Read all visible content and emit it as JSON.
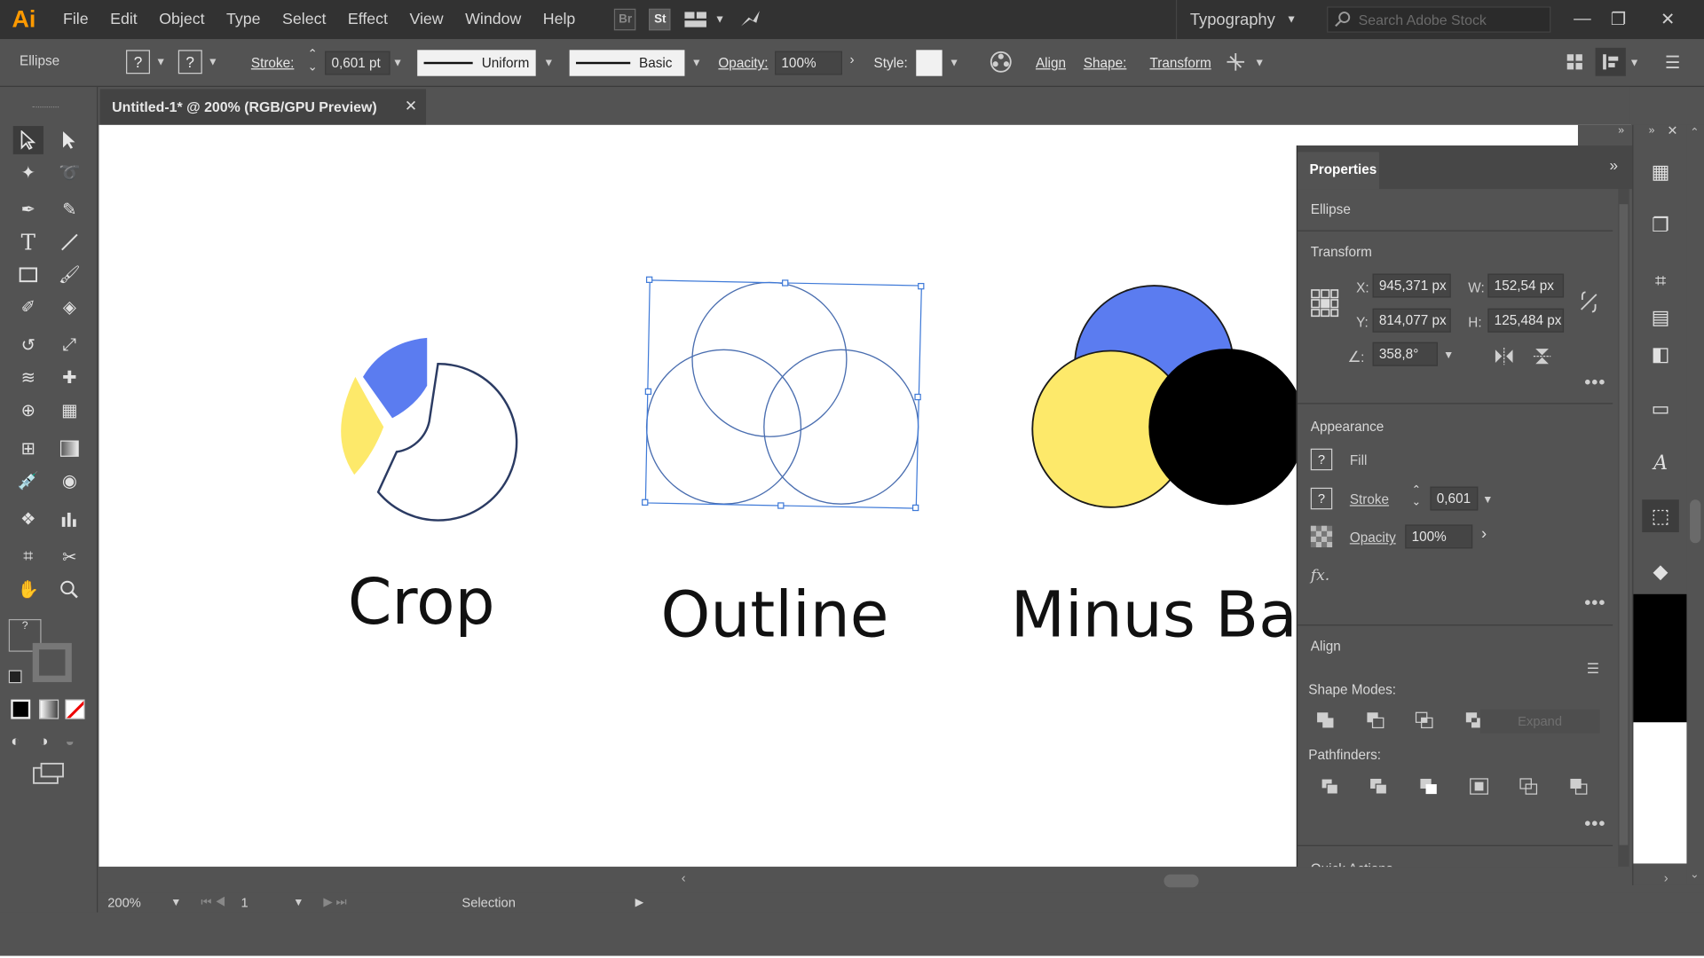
{
  "menubar": {
    "logo": "Ai",
    "items": [
      "File",
      "Edit",
      "Object",
      "Type",
      "Select",
      "Effect",
      "View",
      "Window",
      "Help"
    ],
    "bridge_label": "Br",
    "stock_label": "St",
    "workspace": "Typography",
    "search_placeholder": "Search Adobe Stock"
  },
  "control_bar": {
    "selection_type": "Ellipse",
    "stroke_label": "Stroke:",
    "stroke_value": "0,601 pt",
    "profile_label": "Uniform",
    "brush_label": "Basic",
    "opacity_label": "Opacity:",
    "opacity_value": "100%",
    "style_label": "Style:",
    "align_label": "Align",
    "shape_label": "Shape:",
    "transform_label": "Transform"
  },
  "document": {
    "tab_title": "Untitled-1* @ 200% (RGB/GPU Preview)"
  },
  "artboard": {
    "labels": [
      "Crop",
      "Outline",
      "Minus Bac"
    ],
    "colors": {
      "blue": "#5b7cf0",
      "yellow": "#fde96a",
      "black": "#000000",
      "outline": "#2b3b63",
      "selection": "#4a7bd0"
    }
  },
  "properties": {
    "tab": "Properties",
    "object_type": "Ellipse",
    "transform_title": "Transform",
    "x_label": "X:",
    "x_value": "945,371 px",
    "y_label": "Y:",
    "y_value": "814,077 px",
    "w_label": "W:",
    "w_value": "152,54 px",
    "h_label": "H:",
    "h_value": "125,484 px",
    "angle_value": "358,8°",
    "appearance_title": "Appearance",
    "fill_label": "Fill",
    "stroke_label": "Stroke",
    "stroke_value": "0,601",
    "opacity_label": "Opacity",
    "opacity_value": "100%",
    "fx_label": "fx.",
    "align_title": "Align",
    "shape_modes_title": "Shape Modes:",
    "expand_label": "Expand",
    "pathfinders_title": "Pathfinders:",
    "quick_actions_title": "Quick Actions"
  },
  "status": {
    "zoom": "200%",
    "artboard_number": "1",
    "tool_name": "Selection"
  }
}
